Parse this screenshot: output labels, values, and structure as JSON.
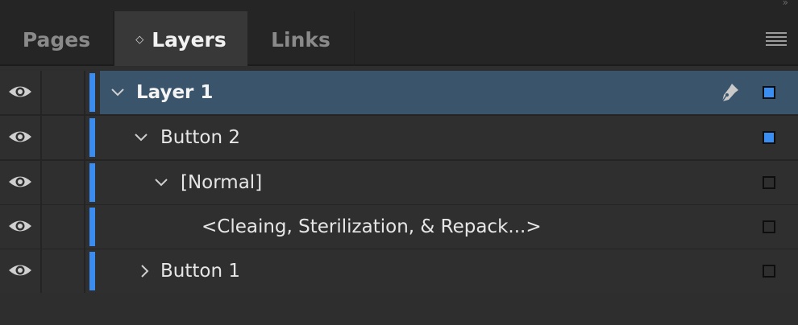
{
  "tabs": {
    "pages": "Pages",
    "layers": "Layers",
    "links": "Links",
    "active_marker": "◇"
  },
  "layer_color": "#3b8cf0",
  "rows": [
    {
      "label": "Layer 1",
      "expanded": true,
      "selected": true,
      "has_pen": true,
      "square_filled": true
    },
    {
      "label": "Button 2",
      "expanded": true,
      "selected": false,
      "has_pen": false,
      "square_filled": true
    },
    {
      "label": "[Normal]",
      "expanded": true,
      "selected": false,
      "has_pen": false,
      "square_filled": false
    },
    {
      "label": "<Cleaing, Sterilization, & Repack...>",
      "expanded": null,
      "selected": false,
      "has_pen": false,
      "square_filled": false
    },
    {
      "label": "Button 1",
      "expanded": false,
      "selected": false,
      "has_pen": false,
      "square_filled": false
    }
  ]
}
